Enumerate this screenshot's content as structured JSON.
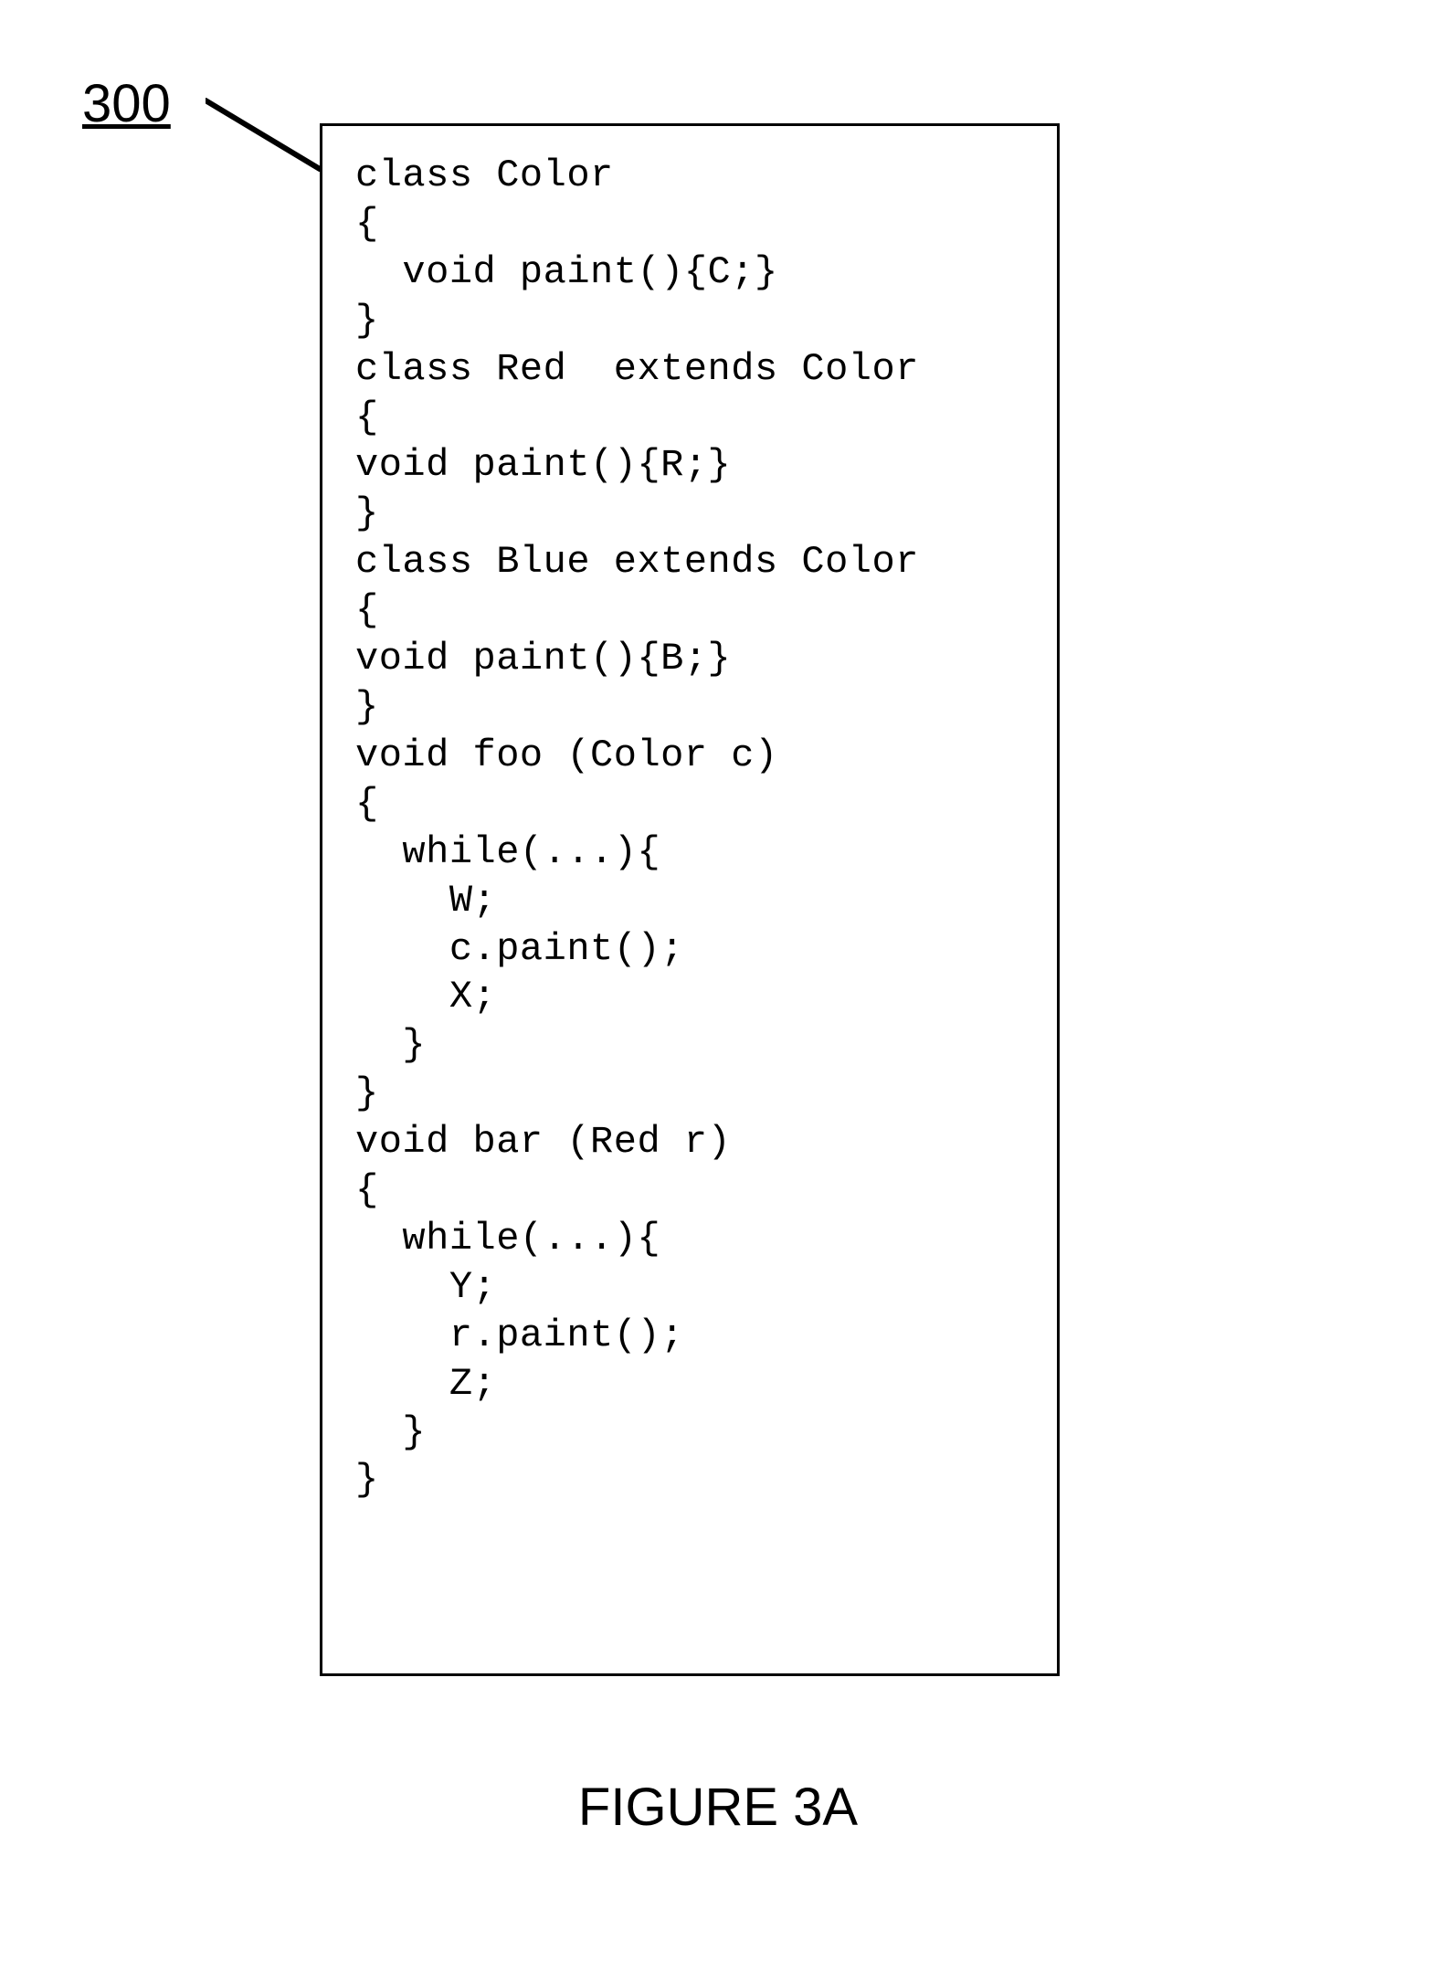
{
  "figure_number": "300",
  "caption": "FIGURE 3A",
  "code_lines": [
    "class Color",
    "{",
    "  void paint(){C;}",
    "}",
    "class Red  extends Color",
    "{",
    "void paint(){R;}",
    "}",
    "class Blue extends Color",
    "{",
    "void paint(){B;}",
    "}",
    "void foo (Color c)",
    "{",
    "  while(...){",
    "    W;",
    "    c.paint();",
    "    X;",
    "  }",
    "}",
    "void bar (Red r)",
    "{",
    "  while(...){",
    "    Y;",
    "    r.paint();",
    "    Z;",
    "  }",
    "}"
  ]
}
